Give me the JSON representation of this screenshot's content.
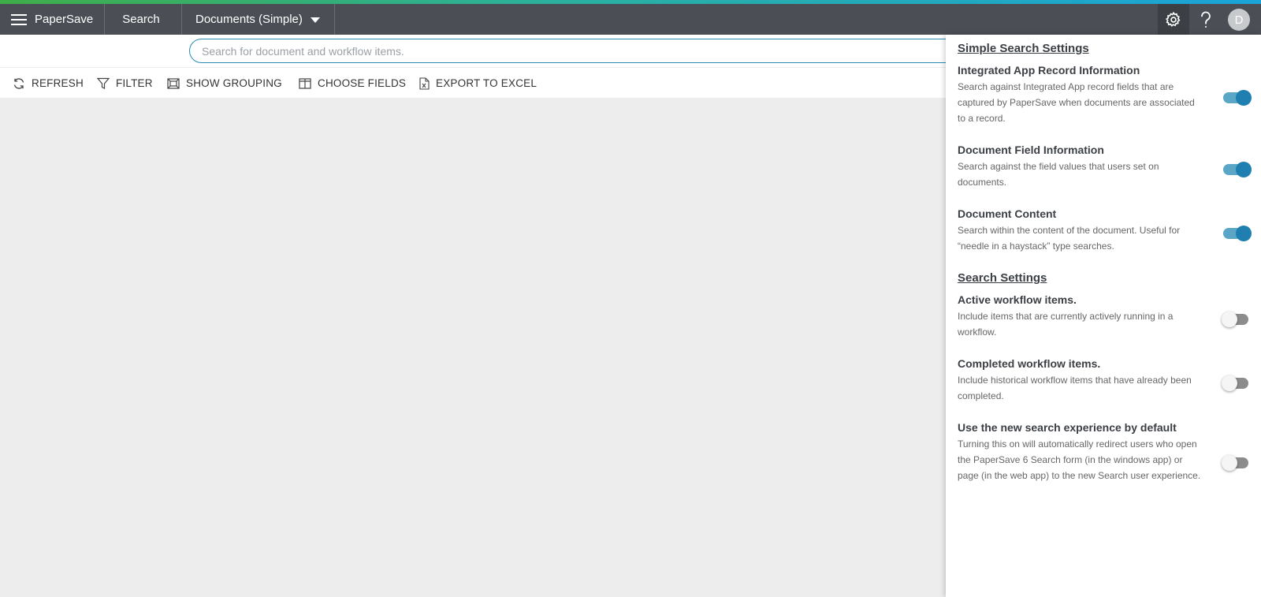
{
  "app": {
    "brand": "PaperSave",
    "nav_search": "Search",
    "nav_documents": "Documents (Simple)",
    "avatar_initial": "D",
    "accent_colors": [
      "#3fae49",
      "#1aa3d9"
    ]
  },
  "search": {
    "placeholder": "Search for document and workflow items.",
    "value": ""
  },
  "toolbar": {
    "refresh": "REFRESH",
    "filter": "FILTER",
    "show_grouping": "SHOW GROUPING",
    "choose_fields": "CHOOSE FIELDS",
    "export_to_excel": "EXPORT TO EXCEL"
  },
  "panel": {
    "simple_title": "Simple Search Settings",
    "simple_options": [
      {
        "title": "Integrated App Record Information",
        "desc": "Search against Integrated App record fields that are captured by PaperSave when documents are associated to a record.",
        "on": true
      },
      {
        "title": "Document Field Information",
        "desc": "Search against the field values that users set on documents.",
        "on": true
      },
      {
        "title": "Document Content",
        "desc": "Search within the content of the document. Useful for “needle in a haystack” type searches.",
        "on": true
      }
    ],
    "search_title": "Search Settings",
    "search_options": [
      {
        "title": "Active workflow items.",
        "desc": "Include items that are currently actively running in a workflow.",
        "on": false
      },
      {
        "title": "Completed workflow items.",
        "desc": "Include historical workflow items that have already been completed.",
        "on": false
      },
      {
        "title": "Use the new search experience by default",
        "desc": "Turning this on will automatically redirect users who open the PaperSave 6 Search form (in the windows app) or page (in the web app) to the new Search user experience.",
        "on": false
      }
    ]
  }
}
